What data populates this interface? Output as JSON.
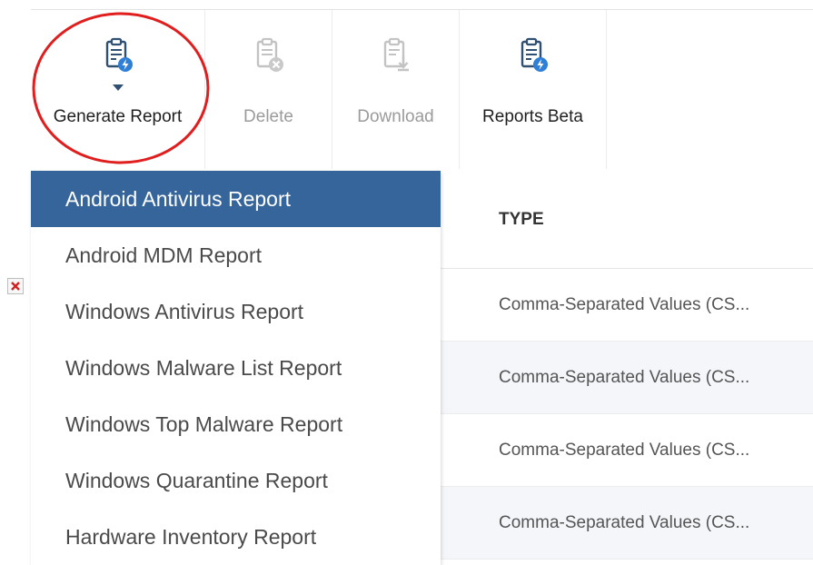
{
  "toolbar": {
    "generate_report": {
      "label": "Generate Report",
      "icon": "clipboard-bolt-icon"
    },
    "delete": {
      "label": "Delete",
      "icon": "clipboard-x-icon"
    },
    "download": {
      "label": "Download",
      "icon": "clipboard-download-icon"
    },
    "reports_beta": {
      "label": "Reports Beta",
      "icon": "clipboard-bolt-icon"
    }
  },
  "menu": {
    "items": [
      {
        "label": "Android Antivirus Report",
        "selected": true
      },
      {
        "label": "Android MDM Report"
      },
      {
        "label": "Windows Antivirus Report"
      },
      {
        "label": "Windows Malware List Report"
      },
      {
        "label": "Windows Top Malware Report"
      },
      {
        "label": "Windows Quarantine Report"
      },
      {
        "label": "Hardware Inventory Report"
      }
    ]
  },
  "table": {
    "columns": {
      "type": "TYPE"
    },
    "rows": [
      {
        "prev": "...",
        "type": "Comma-Separated Values (CS..."
      },
      {
        "prev": "...",
        "type": "Comma-Separated Values (CS..."
      },
      {
        "prev": "...",
        "type": "Comma-Separated Values (CS..."
      },
      {
        "prev": "...",
        "type": "Comma-Separated Values (CS..."
      }
    ]
  },
  "colors": {
    "accent": "#35659b",
    "annotation": "#e01e1e",
    "icon_primary": "#2f4f73",
    "icon_badge": "#2f7fd6",
    "disabled": "#9b9b9b"
  }
}
